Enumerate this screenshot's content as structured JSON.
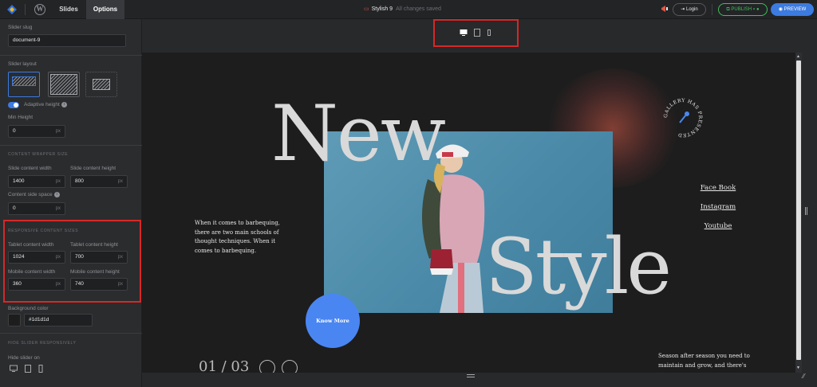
{
  "topbar": {
    "tabs": [
      "Slides",
      "Options"
    ],
    "active_tab": "Options",
    "doc_title": "Stylish 9",
    "save_status": "All changes saved",
    "login_label": "Login",
    "publish_label": "PUBLISH",
    "preview_label": "PREVIEW"
  },
  "sidebar": {
    "slider_slug_label": "Slider slug",
    "slider_slug_value": "document-9",
    "slider_layout_label": "Slider layout",
    "adaptive_height_label": "Adaptive height",
    "min_height_label": "Min Height",
    "min_height_value": "0",
    "unit": "px",
    "content_wrapper_title": "CONTENT WRAPPER SIZE",
    "slide_content_width_label": "Slide content width",
    "slide_content_width_value": "1400",
    "slide_content_height_label": "Slide content height",
    "slide_content_height_value": "800",
    "content_side_space_label": "Content side space",
    "content_side_space_value": "0",
    "responsive_title": "RESPONSIVE CONTENT SIZES",
    "tablet_width_label": "Tablet content width",
    "tablet_width_value": "1024",
    "tablet_height_label": "Tablet content height",
    "tablet_height_value": "700",
    "mobile_width_label": "Mobile content width",
    "mobile_width_value": "360",
    "mobile_height_label": "Mobile content height",
    "mobile_height_value": "740",
    "background_color_label": "Background color",
    "background_color_value": "#1d1d1d",
    "hide_responsive_title": "HIDE SLIDER RESPONSIVELY",
    "hide_slider_on_label": "Hide slider on"
  },
  "slide": {
    "heading_1": "New",
    "heading_2": "Style",
    "paragraph": "When it comes to barbequing, there are two main schools of thought techniques. When it comes to barbequing.",
    "badge_text": "GALLERY HAS PRESENTED",
    "links": [
      "Face Book",
      "Instagram",
      "Youtube"
    ],
    "button_label": "Know More",
    "counter": "01 / 03",
    "season_text": "Season after season you need to maintain and grow, and there's",
    "colors": {
      "background": "#1d1d1d",
      "button": "#4a86f2",
      "accent": "#3c7be0",
      "publish": "#3fbf5c",
      "highlight": "#d62828"
    }
  }
}
